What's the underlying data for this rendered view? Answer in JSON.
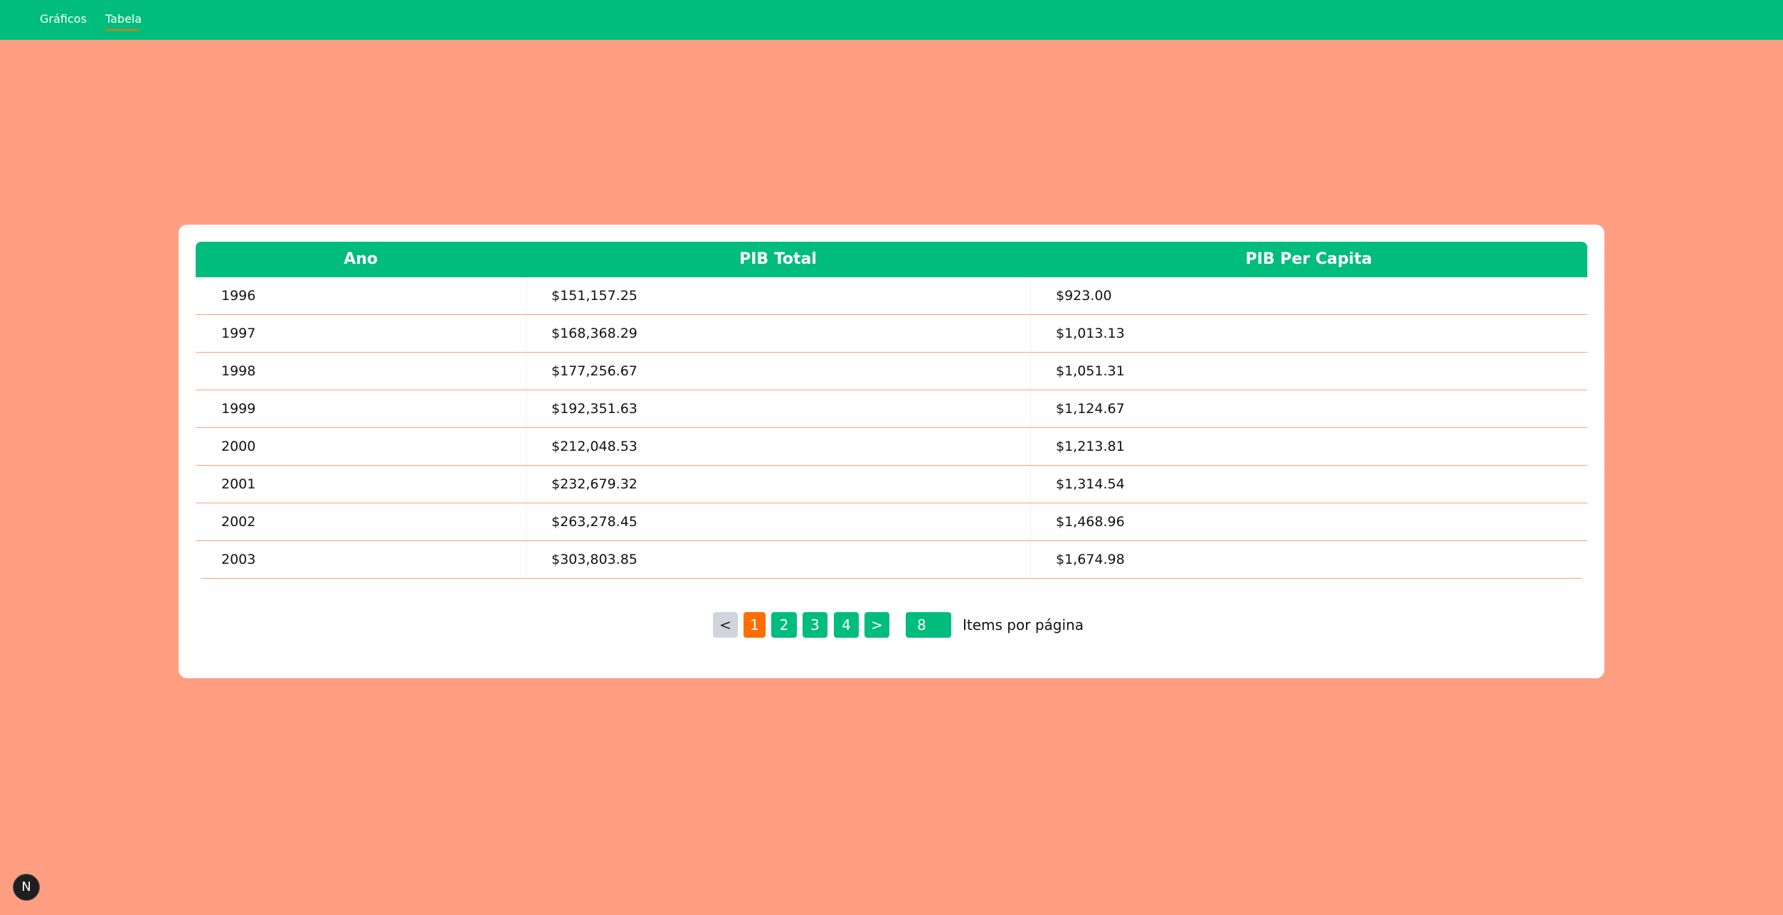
{
  "nav": {
    "items": [
      {
        "label": "Gráficos",
        "active": false
      },
      {
        "label": "Tabela",
        "active": true
      }
    ]
  },
  "table": {
    "headers": [
      "Ano",
      "PIB Total",
      "PIB Per Capita"
    ],
    "rows": [
      [
        "1996",
        "$151,157.25",
        "$923.00"
      ],
      [
        "1997",
        "$168,368.29",
        "$1,013.13"
      ],
      [
        "1998",
        "$177,256.67",
        "$1,051.31"
      ],
      [
        "1999",
        "$192,351.63",
        "$1,124.67"
      ],
      [
        "2000",
        "$212,048.53",
        "$1,213.81"
      ],
      [
        "2001",
        "$232,679.32",
        "$1,314.54"
      ],
      [
        "2002",
        "$263,278.45",
        "$1,468.96"
      ],
      [
        "2003",
        "$303,803.85",
        "$1,674.98"
      ]
    ]
  },
  "pagination": {
    "prev_label": "<",
    "next_label": ">",
    "pages": [
      "1",
      "2",
      "3",
      "4"
    ],
    "current_page": "1",
    "items_per_page_value": "8",
    "items_per_page_label": "Items por página"
  },
  "badge": {
    "label": "N",
    "icon": "nextjs-icon"
  },
  "colors": {
    "primary": "#00bc7d",
    "accent": "#ff6d00",
    "background": "#ff9e80",
    "disabled": "#d1d5db"
  }
}
